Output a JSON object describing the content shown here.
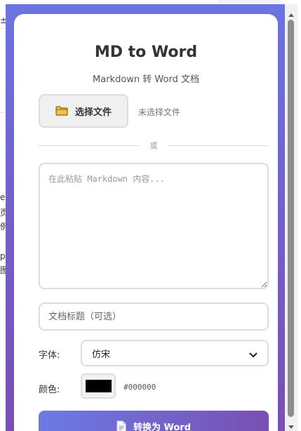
{
  "app": {
    "title": "MD to Word",
    "subtitle": "Markdown 转 Word 文档",
    "accent_gradient": [
      "#6b7be4",
      "#7a4fb3"
    ]
  },
  "file_picker": {
    "button_label": "选择文件",
    "button_icon": "folder-icon",
    "status_text": "未选择文件"
  },
  "divider": {
    "label": "或"
  },
  "markdown_input": {
    "value": "",
    "placeholder": "在此粘贴 Markdown 内容..."
  },
  "doc_title_input": {
    "value": "",
    "placeholder": "文档标题（可选）"
  },
  "font": {
    "label": "字体:",
    "selected": "仿宋"
  },
  "color": {
    "label": "颜色:",
    "value": "#000000",
    "hex_text": "#000000"
  },
  "convert": {
    "label": "转换为 Word",
    "icon": "document-icon"
  },
  "background_fragments": [
    "±",
    "e",
    "页",
    "例",
    "p",
    "图"
  ]
}
